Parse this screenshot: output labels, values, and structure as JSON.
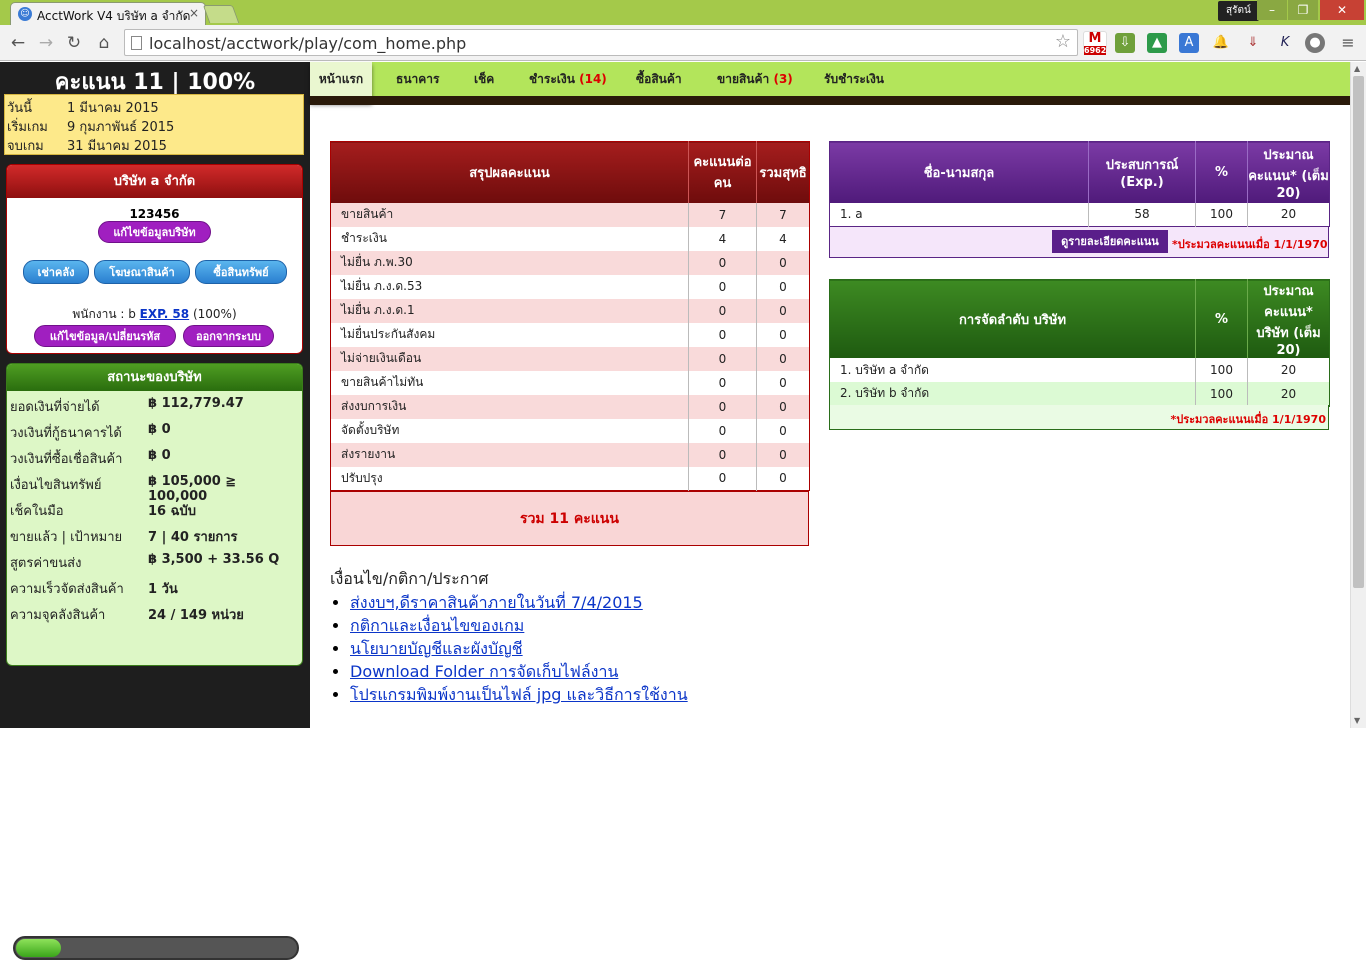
{
  "browser": {
    "tab_title": "AcctWork V4 บริษัท a จำกัด",
    "user_name": "สุรัตน์",
    "url": "localhost/acctwork/play/com_home.php",
    "gmail_count": "6962"
  },
  "sidebar": {
    "score_title": "คะแนน 11 | 100%",
    "dates": [
      {
        "label": "วันนี้",
        "value": "1 มีนาคม 2015"
      },
      {
        "label": "เริ่มเกม",
        "value": "9 กุมภาพันธ์ 2015"
      },
      {
        "label": "จบเกม",
        "value": "31 มีนาคม 2015"
      }
    ],
    "company": {
      "heading": "บริษัท a จำกัด",
      "code": "123456",
      "edit_company_label": "แก้ไขข้อมูลบริษัท",
      "rent_warehouse_label": "เช่าคลัง",
      "advertise_label": "โฆษณาสินค้า",
      "buy_assets_label": "ซื้อสินทรัพย์",
      "staff_prefix": "พนักงาน : b",
      "staff_exp_link": "EXP. 58",
      "staff_percent": "(100%)",
      "edit_profile_label": "แก้ไขข้อมูล/เปลี่ยนรหัส",
      "logout_label": "ออกจากระบบ"
    },
    "status": {
      "heading": "สถานะของบริษัท",
      "rows": [
        {
          "label": "ยอดเงินที่จ่ายได้",
          "value": "฿ 112,779.47"
        },
        {
          "label": "วงเงินที่กู้ธนาคารได้",
          "value": "฿ 0"
        },
        {
          "label": "วงเงินที่ซื้อเชื่อสินค้า",
          "value": "฿ 0"
        },
        {
          "label": "เงื่อนไขสินทรัพย์",
          "value": "฿ 105,000 ≧ 100,000"
        },
        {
          "label": "เช็คในมือ",
          "value": "16 ฉบับ"
        },
        {
          "label": "ขายแล้ว | เป้าหมาย",
          "value": "7 | 40 รายการ"
        },
        {
          "label": "สูตรค่าขนส่ง",
          "value": "฿ 3,500 + 33.56 Q"
        },
        {
          "label": "ความเร็วจัดส่งสินค้า",
          "value": "1 วัน"
        },
        {
          "label": "ความจุคลังสินค้า",
          "value": "24 / 149 หน่วย"
        }
      ],
      "capacity_fraction": 0.161
    }
  },
  "menu": [
    {
      "label": "หน้าแรก",
      "count": ""
    },
    {
      "label": "ธนาคาร",
      "count": ""
    },
    {
      "label": "เช็ค",
      "count": ""
    },
    {
      "label": "ชำระเงิน",
      "count": "(14)"
    },
    {
      "label": "ซื้อสินค้า",
      "count": ""
    },
    {
      "label": "ขายสินค้า",
      "count": "(3)"
    },
    {
      "label": "รับชำระเงิน",
      "count": ""
    }
  ],
  "score_summary": {
    "header_summary": "สรุปผลคะแนน",
    "header_per_person": "คะแนนต่อคน",
    "header_net": "รวมสุทธิ",
    "rows": [
      {
        "label": "ขายสินค้า",
        "per_person": "7",
        "net": "7"
      },
      {
        "label": "ชำระเงิน",
        "per_person": "4",
        "net": "4"
      },
      {
        "label": "ไม่ยื่น ภ.พ.30",
        "per_person": "0",
        "net": "0"
      },
      {
        "label": "ไม่ยื่น ภ.ง.ด.53",
        "per_person": "0",
        "net": "0"
      },
      {
        "label": "ไม่ยื่น ภ.ง.ด.1",
        "per_person": "0",
        "net": "0"
      },
      {
        "label": "ไม่ยื่นประกันสังคม",
        "per_person": "0",
        "net": "0"
      },
      {
        "label": "ไม่จ่ายเงินเดือน",
        "per_person": "0",
        "net": "0"
      },
      {
        "label": "ขายสินค้าไม่ทัน",
        "per_person": "0",
        "net": "0"
      },
      {
        "label": "ส่งงบการเงิน",
        "per_person": "0",
        "net": "0"
      },
      {
        "label": "จัดตั้งบริษัท",
        "per_person": "0",
        "net": "0"
      },
      {
        "label": "ส่งรายงาน",
        "per_person": "0",
        "net": "0"
      },
      {
        "label": "ปรับปรุง",
        "per_person": "0",
        "net": "0"
      }
    ],
    "total": "รวม 11 คะแนน"
  },
  "experience": {
    "header_name": "ชื่อ-นามสกุล",
    "header_exp": "ประสบการณ์ (Exp.)",
    "header_percent": "%",
    "header_estimate": "ประมาณคะแนน* (เต็ม 20)",
    "rows": [
      {
        "name": "1. a",
        "exp": "58",
        "percent": "100",
        "estimate": "20"
      }
    ],
    "detail_button": "ดูรายละเอียดคะแนน",
    "note": "*ประมวลคะแนนเมื่อ 1/1/1970"
  },
  "ranking": {
    "header_company": "การจัดลำดับ บริษัท",
    "header_percent": "%",
    "header_estimate": "ประมาณคะแนน* บริษัท (เต็ม 20)",
    "rows": [
      {
        "company": "1. บริษัท a จำกัด",
        "percent": "100",
        "estimate": "20"
      },
      {
        "company": "2. บริษัท b จำกัด",
        "percent": "100",
        "estimate": "20"
      }
    ],
    "note": "*ประมวลคะแนนเมื่อ 1/1/1970"
  },
  "notices": {
    "title": "เงื่อนไข/กติกา/ประกาศ",
    "links": [
      "ส่งงบฯ,ดีราคาสินค้าภายในวันที่ 7/4/2015",
      "กติกาและเงื่อนไขของเกม",
      "นโยบายบัญชีและผังบัญชี",
      "Download Folder การจัดเก็บไฟล์งาน",
      "โปรแกรมพิมพ์งานเป็นไฟล์ jpg และวิธีการใช้งาน"
    ]
  }
}
